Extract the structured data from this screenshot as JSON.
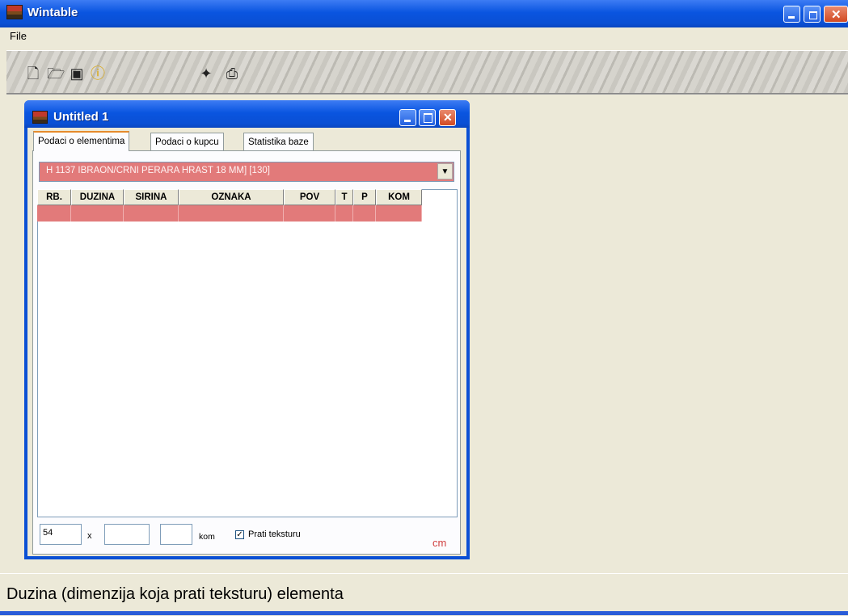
{
  "app": {
    "title": "Wintable"
  },
  "menu": {
    "file": "File"
  },
  "toolbar": {
    "icons": [
      "new-file-icon",
      "open-folder-icon",
      "save-disk-icon",
      "info-icon",
      "plus-icon",
      "printer-icon"
    ]
  },
  "child_window": {
    "title": "Untitled 1"
  },
  "tabs": [
    {
      "label": "Podaci o elementima",
      "active": true
    },
    {
      "label": "Podaci o kupcu",
      "active": false
    },
    {
      "label": "Statistika baze",
      "active": false
    }
  ],
  "material_select": {
    "value": "H 1137 IBRAON/CRNI PERARA HRAST 18 MM] [130]"
  },
  "grid": {
    "columns": [
      "RB.",
      "DUZINA",
      "SIRINA",
      "OZNAKA",
      "POV",
      "T",
      "P",
      "KOM"
    ],
    "rows": [
      [
        "",
        "",
        "",
        "",
        "",
        "",
        "",
        ""
      ]
    ]
  },
  "inputs": {
    "length": "54",
    "width": "",
    "count": "",
    "times": "x",
    "kom_label": "kom"
  },
  "checkbox": {
    "label": "Prati teksturu",
    "checked": true
  },
  "unit": "cm",
  "status": {
    "text": "Duzina (dimenzija koja prati teksturu) elementa"
  },
  "colors": {
    "titlebar": "#0a4fd4",
    "row_highlight": "#e27a7a",
    "accent_tab": "#e68b2c"
  }
}
